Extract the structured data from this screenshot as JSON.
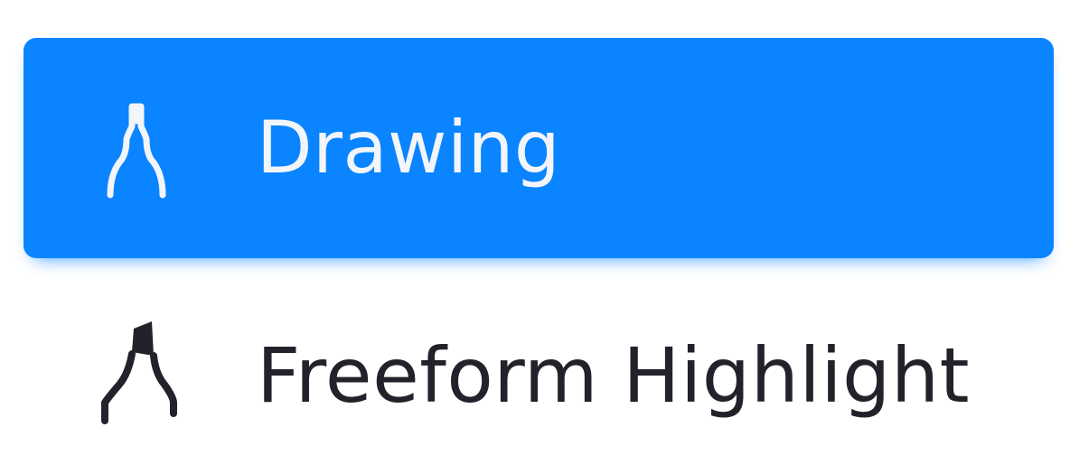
{
  "menu": {
    "items": [
      {
        "label": "Drawing",
        "icon": "pen-nib-outline-icon",
        "selected": true
      },
      {
        "label": "Freeform Highlight",
        "icon": "highlighter-icon",
        "selected": false
      }
    ]
  },
  "colors": {
    "selected_background": "#0A84FF",
    "selected_text": "#F2F5FA",
    "text": "#22222B",
    "background": "#FFFFFF"
  }
}
